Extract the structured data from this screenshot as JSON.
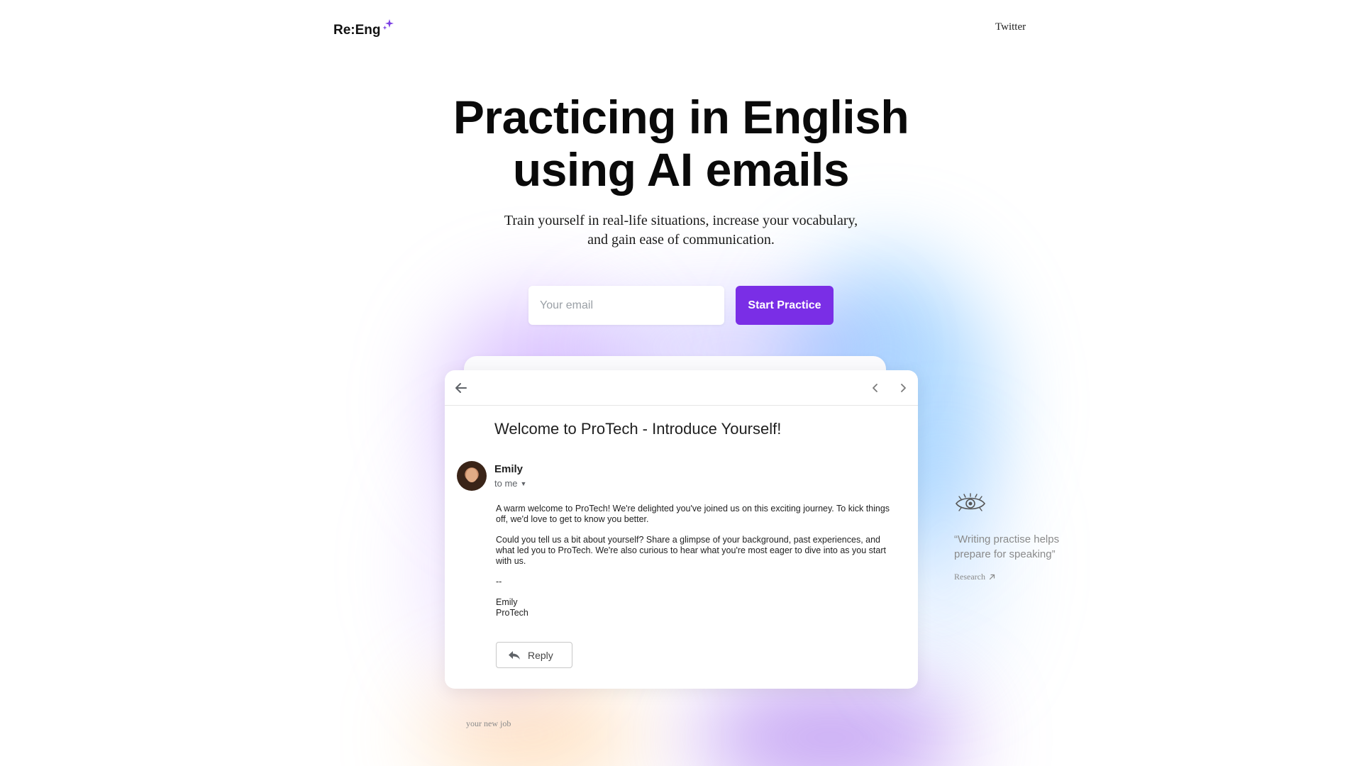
{
  "header": {
    "logo_text": "Re:Eng",
    "logo_icon": "sparkle-icon",
    "nav_link": "Twitter"
  },
  "hero": {
    "title_line1": "Practicing in English",
    "title_line2": "using AI emails",
    "subtitle_line1": "Train yourself in real-life situations, increase your vocabulary,",
    "subtitle_line2": "and gain ease of communication."
  },
  "signup": {
    "email_placeholder": "Your email",
    "button_label": "Start Practice",
    "button_color": "#7a2ee6"
  },
  "email": {
    "subject": "Welcome to ProTech - Introduce Yourself!",
    "sender_name": "Emily",
    "recipient": "to me",
    "body_paragraph1": "A warm welcome to ProTech! We're delighted you've joined us on this exciting journey. To kick things off, we'd love to get to know you better.",
    "body_paragraph2": "Could you tell us a bit about yourself? Share a glimpse of your background, past experiences, and what led you to ProTech. We're also curious to hear what you're most eager to dive into as you start with us.",
    "signature_dash": "--",
    "signature_name": "Emily",
    "signature_company": "ProTech",
    "reply_label": "Reply"
  },
  "side_note": {
    "icon": "eye-icon",
    "quote": "“Writing practise helps prepare for speaking”",
    "link_label": "Research"
  },
  "footnote": "your new job"
}
